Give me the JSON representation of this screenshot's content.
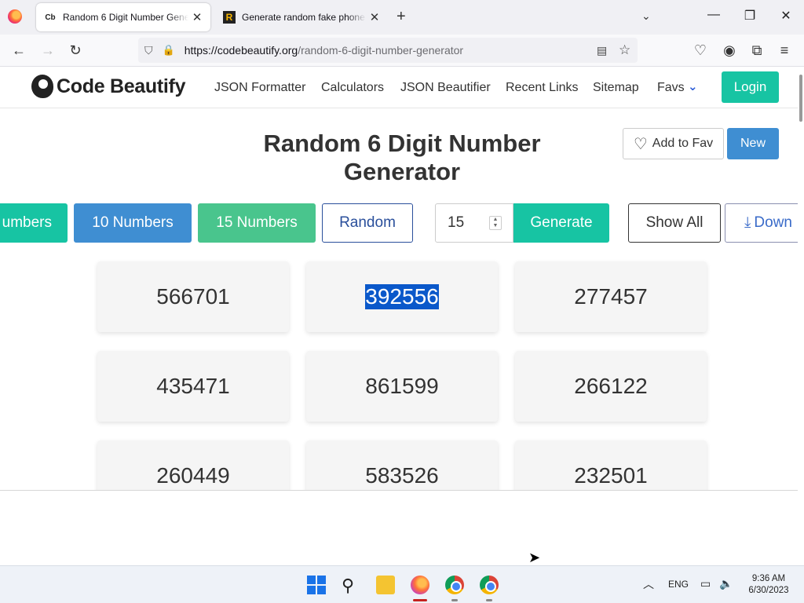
{
  "browser": {
    "tabs": [
      {
        "favicon": "Cb",
        "title": "Random 6 Digit Number Generator",
        "active": true
      },
      {
        "favicon": "R",
        "title": "Generate random fake phone numbers",
        "active": false
      }
    ],
    "new_tab": "+",
    "url_host": "https://codebeautify.org",
    "url_path": "/random-6-digit-number-generator"
  },
  "site": {
    "logo_text": "Code Beautify",
    "menu": [
      "JSON Formatter",
      "Calculators",
      "JSON Beautifier",
      "Recent Links",
      "Sitemap",
      "Favs"
    ],
    "login": "Login"
  },
  "page": {
    "title": "Random 6 Digit Number Generator",
    "add_to_fav": "Add to Fav",
    "new": "New",
    "buttons": {
      "numbers_partial": "umbers",
      "ten": "10 Numbers",
      "fifteen": "15 Numbers",
      "random": "Random",
      "count_value": "15",
      "generate": "Generate",
      "show_all": "Show All",
      "download_partial": "Down"
    },
    "numbers": [
      "566701",
      "392556",
      "277457",
      "435471",
      "861599",
      "266122",
      "260449",
      "583526",
      "232501"
    ],
    "selected_number": "392556"
  },
  "taskbar": {
    "lang": "ENG",
    "time": "9:36 AM",
    "date": "6/30/2023"
  },
  "colors": {
    "teal": "#17c4a3",
    "blue": "#3f8ed2",
    "green": "#49c58d",
    "selection": "#0a58ca"
  }
}
